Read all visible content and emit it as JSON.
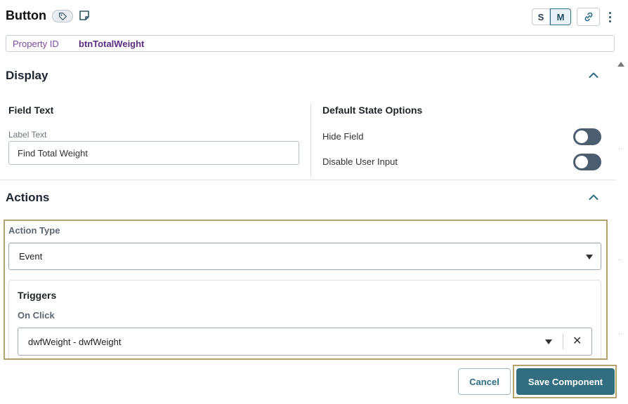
{
  "header": {
    "title": "Button",
    "size_options": [
      "S",
      "M"
    ],
    "active_size": "M"
  },
  "property": {
    "label": "Property ID",
    "value": "btnTotalWeight"
  },
  "display": {
    "title": "Display",
    "field_text": {
      "title": "Field Text",
      "label_text_label": "Label Text",
      "label_text_value": "Find Total Weight"
    },
    "default_state": {
      "title": "Default State Options",
      "hide_field": "Hide Field",
      "hide_field_on": false,
      "disable_input": "Disable User Input",
      "disable_input_on": false
    }
  },
  "actions": {
    "title": "Actions",
    "action_type_label": "Action Type",
    "action_type_value": "Event",
    "triggers_title": "Triggers",
    "on_click_label": "On Click",
    "on_click_value": "dwfWeight - dwfWeight"
  },
  "footer": {
    "cancel_label": "Cancel",
    "save_label": "Save Component"
  },
  "colors": {
    "accent": "#336e80",
    "highlight": "#b2a36a",
    "purple": "#5a2d82"
  }
}
